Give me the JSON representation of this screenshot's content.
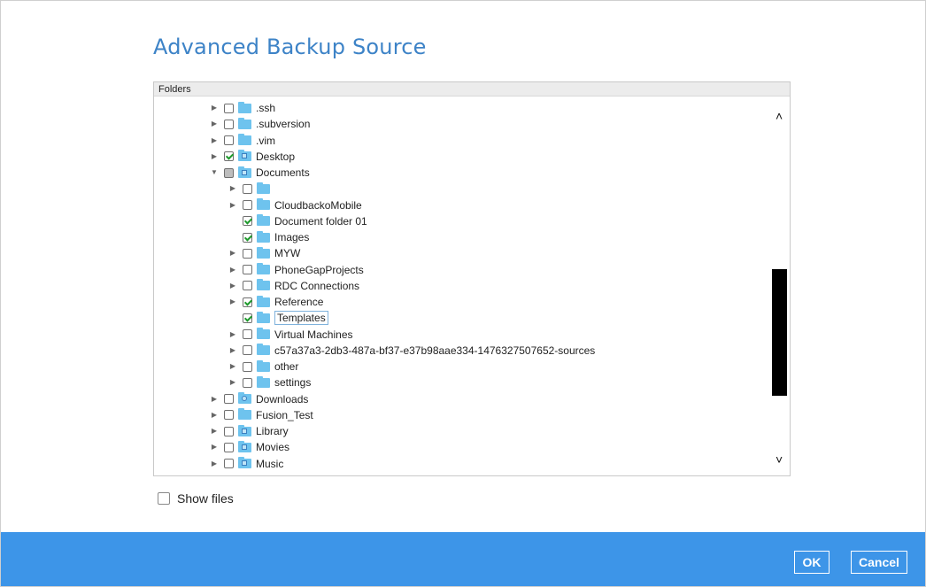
{
  "dialog": {
    "title": "Advanced Backup Source"
  },
  "tree": {
    "header": "Folders",
    "rows": [
      {
        "label": ".ssh",
        "level": 0,
        "expander": "collapsed",
        "check": "unchecked",
        "icon": "folder"
      },
      {
        "label": ".subversion",
        "level": 0,
        "expander": "collapsed",
        "check": "unchecked",
        "icon": "folder"
      },
      {
        "label": ".vim",
        "level": 0,
        "expander": "collapsed",
        "check": "unchecked",
        "icon": "folder"
      },
      {
        "label": "Desktop",
        "level": 0,
        "expander": "collapsed",
        "check": "checked",
        "icon": "desktop-folder"
      },
      {
        "label": "Documents",
        "level": 0,
        "expander": "expanded",
        "check": "partial",
        "icon": "documents-folder"
      },
      {
        "label": "",
        "level": 1,
        "expander": "collapsed",
        "check": "unchecked",
        "icon": "folder"
      },
      {
        "label": "CloudbackoMobile",
        "level": 1,
        "expander": "collapsed",
        "check": "unchecked",
        "icon": "folder"
      },
      {
        "label": "Document folder 01",
        "level": 1,
        "expander": "none",
        "check": "checked",
        "icon": "folder"
      },
      {
        "label": "Images",
        "level": 1,
        "expander": "none",
        "check": "checked",
        "icon": "folder"
      },
      {
        "label": "MYW",
        "level": 1,
        "expander": "collapsed",
        "check": "unchecked",
        "icon": "folder"
      },
      {
        "label": "PhoneGapProjects",
        "level": 1,
        "expander": "collapsed",
        "check": "unchecked",
        "icon": "folder"
      },
      {
        "label": "RDC Connections",
        "level": 1,
        "expander": "collapsed",
        "check": "unchecked",
        "icon": "folder"
      },
      {
        "label": "Reference",
        "level": 1,
        "expander": "collapsed",
        "check": "checked",
        "icon": "folder"
      },
      {
        "label": "Templates",
        "level": 1,
        "expander": "none",
        "check": "checked",
        "icon": "folder",
        "selected": true
      },
      {
        "label": "Virtual Machines",
        "level": 1,
        "expander": "collapsed",
        "check": "unchecked",
        "icon": "folder"
      },
      {
        "label": "c57a37a3-2db3-487a-bf37-e37b98aae334-1476327507652-sources",
        "level": 1,
        "expander": "collapsed",
        "check": "unchecked",
        "icon": "folder"
      },
      {
        "label": "other",
        "level": 1,
        "expander": "collapsed",
        "check": "unchecked",
        "icon": "folder"
      },
      {
        "label": "settings",
        "level": 1,
        "expander": "collapsed",
        "check": "unchecked",
        "icon": "folder"
      },
      {
        "label": "Downloads",
        "level": 0,
        "expander": "collapsed",
        "check": "unchecked",
        "icon": "downloads-folder"
      },
      {
        "label": "Fusion_Test",
        "level": 0,
        "expander": "collapsed",
        "check": "unchecked",
        "icon": "folder"
      },
      {
        "label": "Library",
        "level": 0,
        "expander": "collapsed",
        "check": "unchecked",
        "icon": "library-folder"
      },
      {
        "label": "Movies",
        "level": 0,
        "expander": "collapsed",
        "check": "unchecked",
        "icon": "movies-folder"
      },
      {
        "label": "Music",
        "level": 0,
        "expander": "collapsed",
        "check": "unchecked",
        "icon": "music-folder"
      }
    ]
  },
  "show_files": {
    "label": "Show files",
    "checked": false
  },
  "buttons": {
    "ok": "OK",
    "cancel": "Cancel"
  },
  "colors": {
    "title": "#3d83c7",
    "footer": "#3d95e8",
    "folder": "#6ec3ee",
    "check": "#1f9a2d"
  }
}
